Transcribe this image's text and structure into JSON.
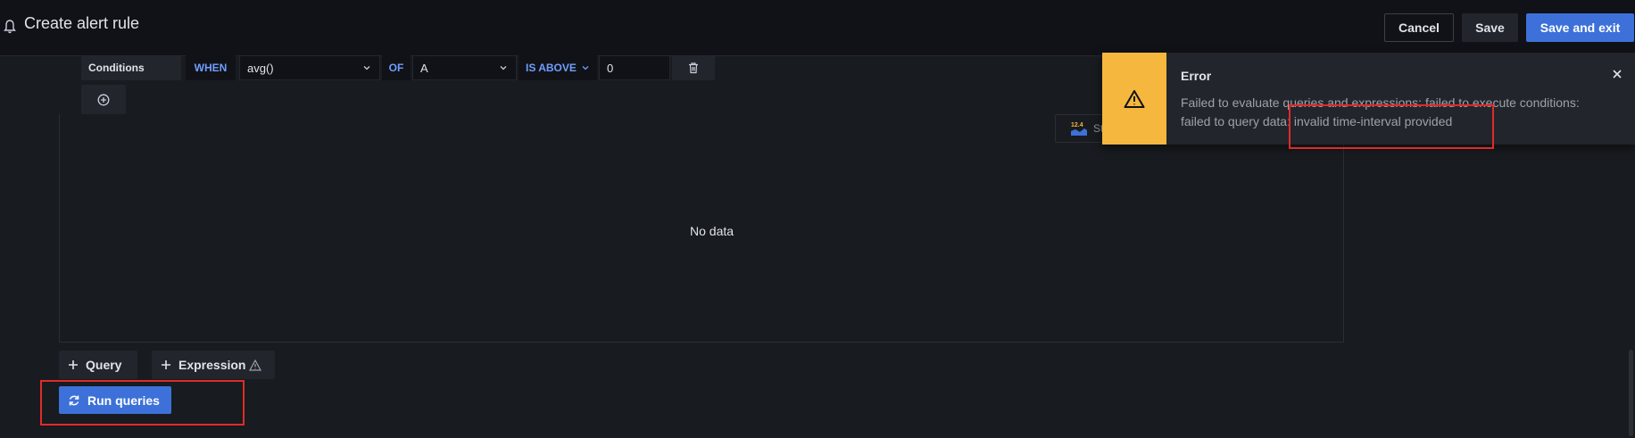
{
  "header": {
    "title": "Create alert rule",
    "cancel_label": "Cancel",
    "save_label": "Save",
    "save_exit_label": "Save and exit"
  },
  "conditions": {
    "label": "Conditions",
    "when": "WHEN",
    "reducer": "avg()",
    "of": "OF",
    "query": "A",
    "evaluator": "IS ABOVE",
    "threshold": "0"
  },
  "panel": {
    "no_data": "No data",
    "stat_badge": "12.4",
    "stat_label": "St"
  },
  "actions": {
    "query_label": "Query",
    "expression_label": "Expression",
    "run_label": "Run queries"
  },
  "toast": {
    "title": "Error",
    "message": "Failed to evaluate queries and expressions: failed to execute conditions: failed to query data: invalid time-interval provided"
  },
  "colors": {
    "primary": "#3d71d9",
    "warning": "#f5b73d",
    "highlight": "#e02b27",
    "keyword": "#6e9fff"
  },
  "icons": [
    "bell-icon",
    "chevron-down-icon",
    "trash-icon",
    "plus-circle-icon",
    "plus-icon",
    "warning-icon",
    "sync-icon",
    "close-icon"
  ]
}
